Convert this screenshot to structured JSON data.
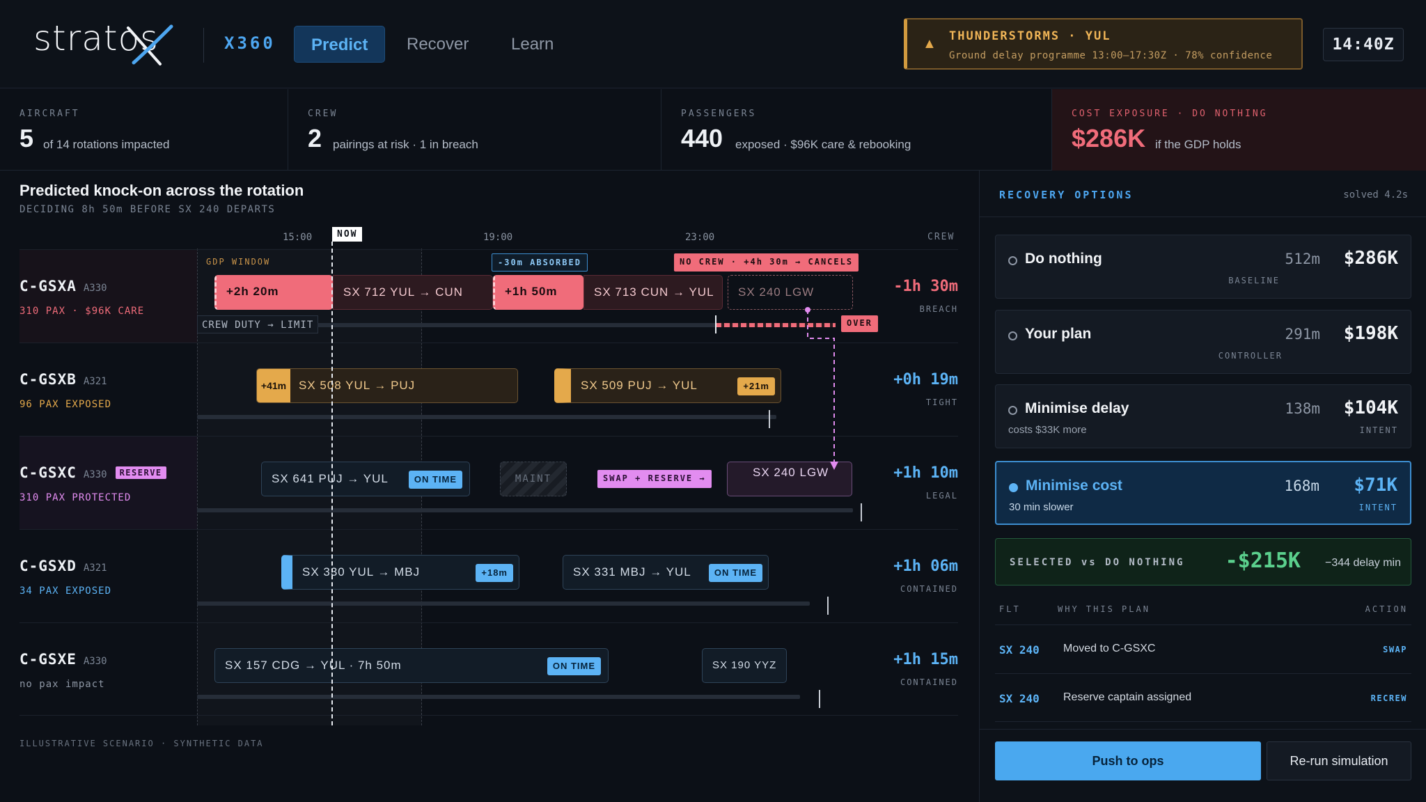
{
  "header": {
    "logo_text": "stratos",
    "product": "X360",
    "nav": [
      "Predict",
      "Recover",
      "Learn"
    ],
    "alert_title": "THUNDERSTORMS · YUL",
    "alert_sub": "Ground delay programme 13:00–17:30Z · 78% confidence",
    "clock": "14:40Z"
  },
  "kpis": [
    {
      "label": "AIRCRAFT",
      "value": "5",
      "desc": "of 14 rotations impacted"
    },
    {
      "label": "CREW",
      "value": "2",
      "desc": "pairings at risk · 1 in breach"
    },
    {
      "label": "PASSENGERS",
      "value": "440",
      "desc": "exposed · $96K care & rebooking"
    },
    {
      "label": "COST EXPOSURE · DO NOTHING",
      "value": "$286K",
      "desc": "if the GDP holds"
    }
  ],
  "gantt": {
    "title": "Predicted knock-on across the rotation",
    "subtitle": "DECIDING 8h 50m BEFORE SX 240 DEPARTS",
    "ticks": [
      "15:00",
      "19:00",
      "23:00"
    ],
    "crew_header": "CREW",
    "now": "NOW",
    "gdp_window": "GDP WINDOW",
    "absorbed": "-30m ABSORBED",
    "no_crew": "NO CREW · +4h 30m → CANCELS",
    "crew_duty": "CREW DUTY → LIMIT",
    "over": "OVER",
    "maint": "MAINT",
    "swap": "SWAP + RESERVE →",
    "footer": "ILLUSTRATIVE SCENARIO · SYNTHETIC DATA",
    "rows": [
      {
        "tail": "C-GSXA",
        "type": "A330",
        "pax": "310 PAX · $96K CARE",
        "slack": "-1h 30m",
        "status": "BREACH",
        "d1": "+2h 20m",
        "f1": "SX 712   YUL → CUN",
        "d2": "+1h 50m",
        "f2": "SX 713   CUN → YUL",
        "f3": "SX 240   LGW"
      },
      {
        "tail": "C-GSXB",
        "type": "A321",
        "pax": "96 PAX EXPOSED",
        "slack": "+0h 19m",
        "status": "TIGHT",
        "d1": "+41m",
        "f1": "SX 508   YUL → PUJ",
        "f2": "SX 509   PUJ → YUL",
        "d2": "+21m"
      },
      {
        "tail": "C-GSXC",
        "type": "A330",
        "badge": "RESERVE",
        "pax": "310 PAX PROTECTED",
        "slack": "+1h 10m",
        "status": "LEGAL",
        "f1": "SX 641   PUJ → YUL",
        "p1": "ON TIME",
        "f2": "SX 240   LGW"
      },
      {
        "tail": "C-GSXD",
        "type": "A321",
        "pax": "34 PAX EXPOSED",
        "slack": "+1h 06m",
        "status": "CONTAINED",
        "f1": "SX 330   YUL → MBJ",
        "d1": "+18m",
        "f2": "SX 331   MBJ → YUL",
        "p2": "ON TIME"
      },
      {
        "tail": "C-GSXE",
        "type": "A330",
        "pax": "no pax impact",
        "slack": "+1h 15m",
        "status": "CONTAINED",
        "f1": "SX 157   CDG → YUL   ·   7h 50m",
        "p1": "ON TIME",
        "f2": "SX 190   YYZ"
      }
    ]
  },
  "recovery": {
    "title": "RECOVERY OPTIONS",
    "solved": "solved 4.2s",
    "options": [
      {
        "name": "Do nothing",
        "sub": "",
        "minutes": "512m",
        "cost": "$286K",
        "tag": "BASELINE"
      },
      {
        "name": "Your plan",
        "sub": "",
        "minutes": "291m",
        "cost": "$198K",
        "tag": "CONTROLLER"
      },
      {
        "name": "Minimise delay",
        "sub": "costs $33K more",
        "minutes": "138m",
        "cost": "$104K",
        "tag": "INTENT"
      },
      {
        "name": "Minimise cost",
        "sub": "30 min slower",
        "minutes": "168m",
        "cost": "$71K",
        "tag": "INTENT"
      }
    ],
    "compare_label": "SELECTED vs DO NOTHING",
    "compare_value": "-$215K",
    "compare_sub": "−344 delay min",
    "table_headers": [
      "FLT",
      "WHY THIS PLAN",
      "ACTION"
    ],
    "actions": [
      {
        "flt": "SX 240",
        "why": "Moved to C-GSXC",
        "act": "SWAP"
      },
      {
        "flt": "SX 240",
        "why": "Reserve captain assigned",
        "act": "RECREW"
      }
    ],
    "push_label": "Push to ops",
    "rerun_label": "Re-run simulation"
  },
  "colors": {
    "accent": "#4da6f0",
    "danger": "#f06c7a",
    "amber": "#e4a94b",
    "purple": "#e28cf0",
    "success": "#5bd08d"
  }
}
